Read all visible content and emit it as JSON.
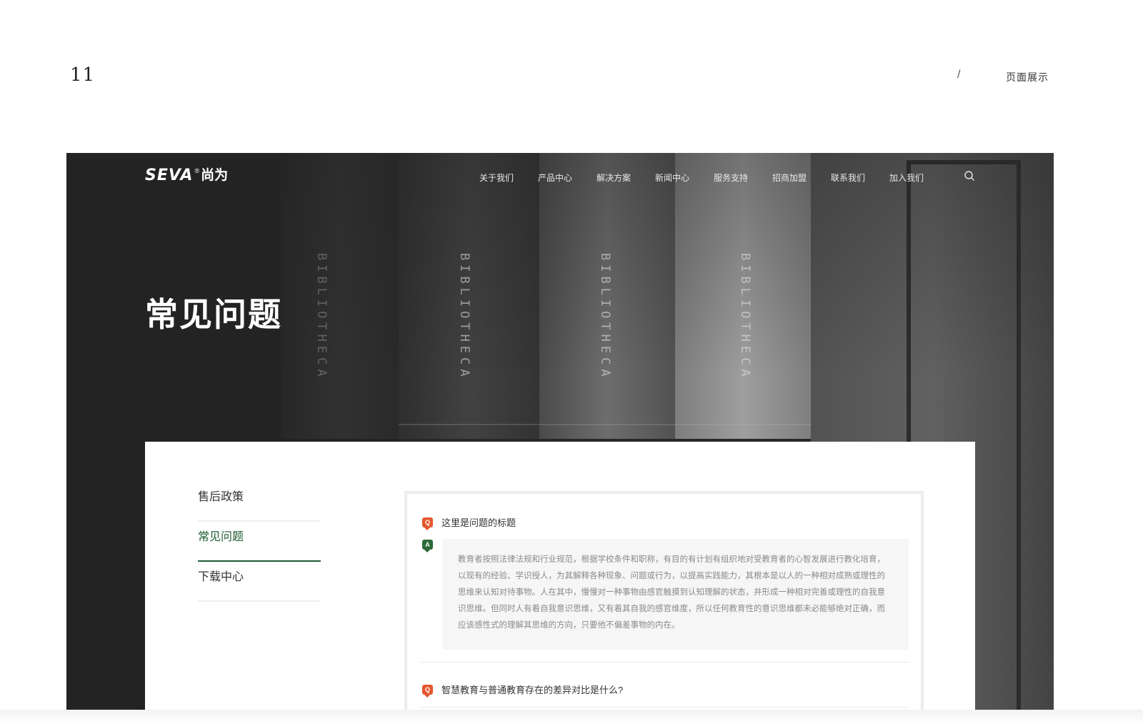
{
  "slide": {
    "number": "11",
    "separator": "/",
    "section": "页面展示"
  },
  "header": {
    "logo_latin": "SEVA",
    "logo_reg": "®",
    "logo_cn": "尚为",
    "nav": [
      "关于我们",
      "产品中心",
      "解决方案",
      "新闻中心",
      "服务支持",
      "招商加盟",
      "联系我们",
      "加入我们"
    ]
  },
  "hero": {
    "title": "常见问题",
    "spine_text": "BIBLIOTHECA"
  },
  "sidebar": {
    "items": [
      {
        "label": "售后政策"
      },
      {
        "label": "常见问题"
      },
      {
        "label": "下载中心"
      }
    ],
    "active": "常见问题"
  },
  "faq": {
    "items": [
      {
        "question": "这里是问题的标题",
        "answer": "教育者按照法律法规和行业规范，根据学校条件和职称，有目的有计划有组织地对受教育者的心智发展进行教化培育，以现有的经验、学识授人，为其解释各种现象、问题或行为，以提高实践能力，其根本是以人的一种相对成熟或理性的思维来认知对待事物。人在其中，慢慢对一种事物由感官触摸到认知理解的状态，并形成一种相对完善或理性的自我意识思维。但同时人有着自我意识思维，又有着其自我的感官维度，所以任何教育性的意识思维都未必能够绝对正确，而应该感性式的理解其思维的方向，只要他不偏差事物的内在。"
      },
      {
        "question": "智慧教育与普通教育存在的差异对比是什么?"
      }
    ],
    "q_badge": "Q",
    "a_badge": "A"
  },
  "colors": {
    "accent_green": "#1f5c33",
    "question_badge": "#e4572e",
    "answer_badge": "#2b6a3a",
    "hero_dark": "#232323"
  }
}
